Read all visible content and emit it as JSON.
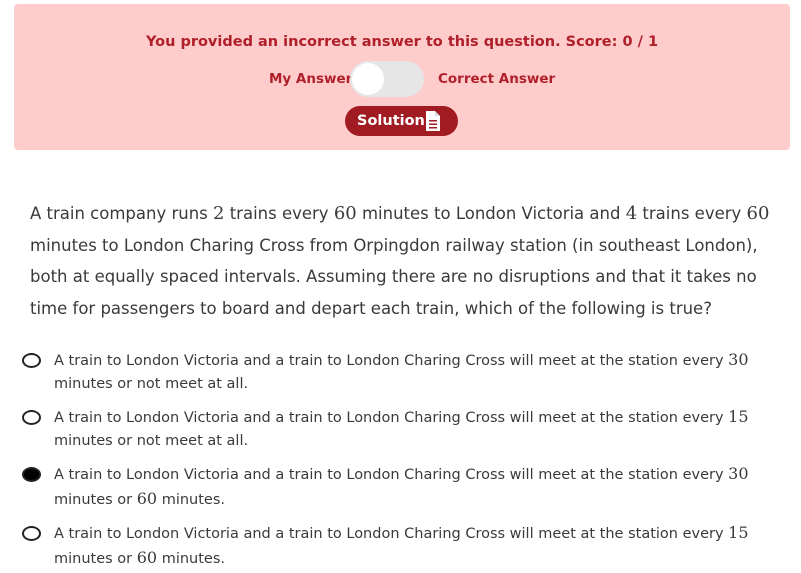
{
  "feedback": {
    "message": "You provided an incorrect answer to this question. Score: 0 / 1",
    "toggle_left_label": "My Answer",
    "toggle_right_label": "Correct Answer",
    "toggle_state": "my-answer",
    "solution_label": "Solution"
  },
  "question": {
    "parts": [
      "A train company runs ",
      "2",
      " trains every ",
      "60",
      " minutes to London Victoria and ",
      "4",
      " trains every ",
      "60",
      " minutes to London Charing Cross from Orpingdon railway station (in southeast London), both at equally spaced intervals. Assuming there are no disruptions and that it takes no time for passengers to board and depart each train, which of the following is true?"
    ]
  },
  "options": [
    {
      "parts": [
        "A train to London Victoria and a train to London Charing Cross will meet at the station every ",
        "30",
        " minutes or not meet at all."
      ],
      "selected": false
    },
    {
      "parts": [
        "A train to London Victoria and a train to London Charing Cross will meet at the station every ",
        "15",
        " minutes or not meet at all."
      ],
      "selected": false
    },
    {
      "parts": [
        "A train to London Victoria and a train to London Charing Cross will meet at the station every ",
        "30",
        " minutes or ",
        "60",
        " minutes."
      ],
      "selected": true
    },
    {
      "parts": [
        "A train to London Victoria and a train to London Charing Cross will meet at the station every ",
        "15",
        " minutes or ",
        "60",
        " minutes."
      ],
      "selected": false
    }
  ]
}
